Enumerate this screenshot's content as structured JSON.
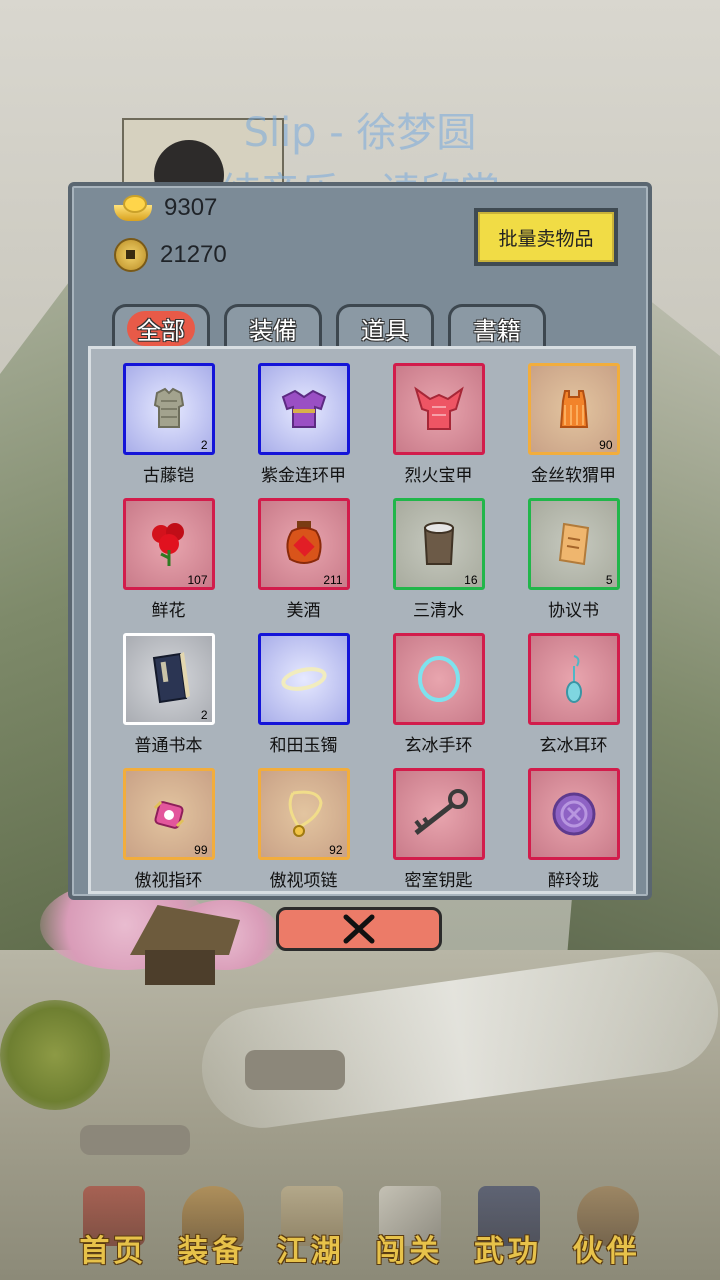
{
  "lyrics": {
    "line1": "Slip - 徐梦圆",
    "line2": "纯音乐，请欣赏"
  },
  "currency": {
    "silver": "9307",
    "copper": "21270"
  },
  "bulk_sell_label": "批量卖物品",
  "tabs": [
    {
      "label": "全部",
      "active": true
    },
    {
      "label": "装備",
      "active": false
    },
    {
      "label": "道具",
      "active": false
    },
    {
      "label": "書籍",
      "active": false
    }
  ],
  "items": [
    {
      "name": "古藤铠",
      "count": "2",
      "quality": "blue",
      "icon": "armor-vest-icon"
    },
    {
      "name": "紫金连环甲",
      "count": "",
      "quality": "blue",
      "icon": "purple-armor-icon"
    },
    {
      "name": "烈火宝甲",
      "count": "",
      "quality": "red",
      "icon": "fire-armor-icon"
    },
    {
      "name": "金丝软猬甲",
      "count": "90",
      "quality": "orange",
      "icon": "golden-armor-icon"
    },
    {
      "name": "鲜花",
      "count": "107",
      "quality": "red",
      "icon": "rose-icon"
    },
    {
      "name": "美酒",
      "count": "211",
      "quality": "red",
      "icon": "wine-jar-icon"
    },
    {
      "name": "三清水",
      "count": "16",
      "quality": "green",
      "icon": "water-bucket-icon"
    },
    {
      "name": "协议书",
      "count": "5",
      "quality": "green",
      "icon": "contract-scroll-icon"
    },
    {
      "name": "普通书本",
      "count": "2",
      "quality": "white",
      "icon": "book-icon"
    },
    {
      "name": "和田玉镯",
      "count": "",
      "quality": "blue",
      "icon": "jade-bracelet-icon"
    },
    {
      "name": "玄冰手环",
      "count": "",
      "quality": "red",
      "icon": "ice-bracelet-icon"
    },
    {
      "name": "玄冰耳环",
      "count": "",
      "quality": "red",
      "icon": "ice-earring-icon"
    },
    {
      "name": "傲视指环",
      "count": "99",
      "quality": "orange",
      "icon": "gem-ring-icon"
    },
    {
      "name": "傲视项链",
      "count": "92",
      "quality": "orange",
      "icon": "necklace-icon"
    },
    {
      "name": "密室钥匙",
      "count": "",
      "quality": "red",
      "icon": "key-icon"
    },
    {
      "name": "醉玲珑",
      "count": "",
      "quality": "red",
      "icon": "purple-seal-icon"
    }
  ],
  "nav": [
    {
      "label": "首页",
      "icon": "pavilion-icon"
    },
    {
      "label": "装备",
      "icon": "armor-icon"
    },
    {
      "label": "江湖",
      "icon": "scroll-map-icon"
    },
    {
      "label": "闯关",
      "icon": "crossed-swords-icon"
    },
    {
      "label": "武功",
      "icon": "martial-book-icon"
    },
    {
      "label": "伙伴",
      "icon": "companions-icon"
    }
  ],
  "colors": {
    "quality_blue": "#1414d8",
    "quality_red": "#d21c4b",
    "quality_orange": "#f2ad3c",
    "quality_green": "#21b64a",
    "quality_white": "#ffffff",
    "bulk_button": "#f1dc45",
    "close_button": "#ec7b68",
    "nav_text": "#e7c24a"
  }
}
